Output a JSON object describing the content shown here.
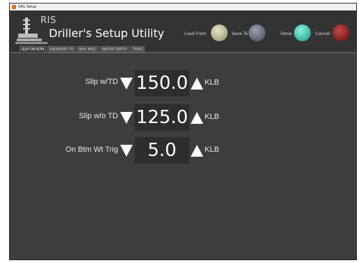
{
  "window": {
    "title": "DRL Setup"
  },
  "header": {
    "logo_text": "RIS",
    "app_title": "Driller's Setup Utility",
    "load_from_label": "Load From",
    "save_to_label": "Save To",
    "done_label": "Done",
    "cancel_label": "Cancel"
  },
  "tabs": [
    {
      "label": "SLIP ON BTM"
    },
    {
      "label": "KNOBRIES TD"
    },
    {
      "label": "BHA MISC"
    },
    {
      "label": "WATER DEPTH"
    },
    {
      "label": "TIDES"
    }
  ],
  "settings": [
    {
      "label": "Slip w/TD",
      "value": "150.0",
      "unit": "KLB"
    },
    {
      "label": "Slip w/o TD",
      "value": "125.0",
      "unit": "KLB"
    },
    {
      "label": "On Btm Wt Trig",
      "value": "5.0",
      "unit": "KLB"
    }
  ],
  "colors": {
    "load_orb": "#c9c9a8",
    "save_orb": "#6b7280",
    "done_orb": "#3fb7a0",
    "cancel_orb": "#8b1d1d",
    "panel_bg": "#3d3d3d"
  }
}
